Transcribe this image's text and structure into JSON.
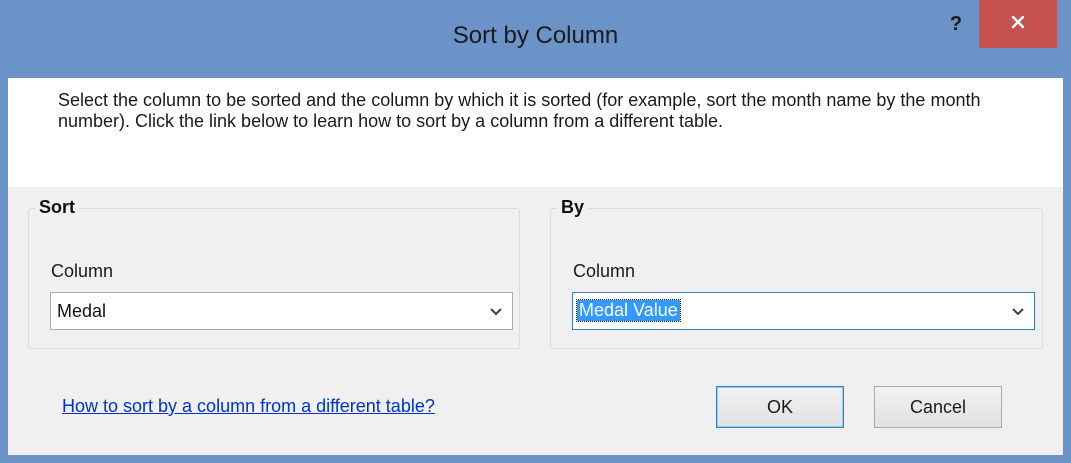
{
  "window": {
    "title": "Sort by Column",
    "help_label": "?",
    "close_icon": "close-icon",
    "title_bar_color": "#6b93c8",
    "close_button_color": "#c75050"
  },
  "description": "Select the column to be sorted and the column by which it is sorted (for example, sort the month name by the month number). Click the link below to learn how to sort by a column from a different table.",
  "sort_group": {
    "legend": "Sort",
    "column_label": "Column",
    "column_value": "Medal"
  },
  "by_group": {
    "legend": "By",
    "column_label": "Column",
    "column_value": "Medal Value"
  },
  "help_link": "How to sort by a column from a different table?",
  "buttons": {
    "ok": "OK",
    "cancel": "Cancel"
  }
}
